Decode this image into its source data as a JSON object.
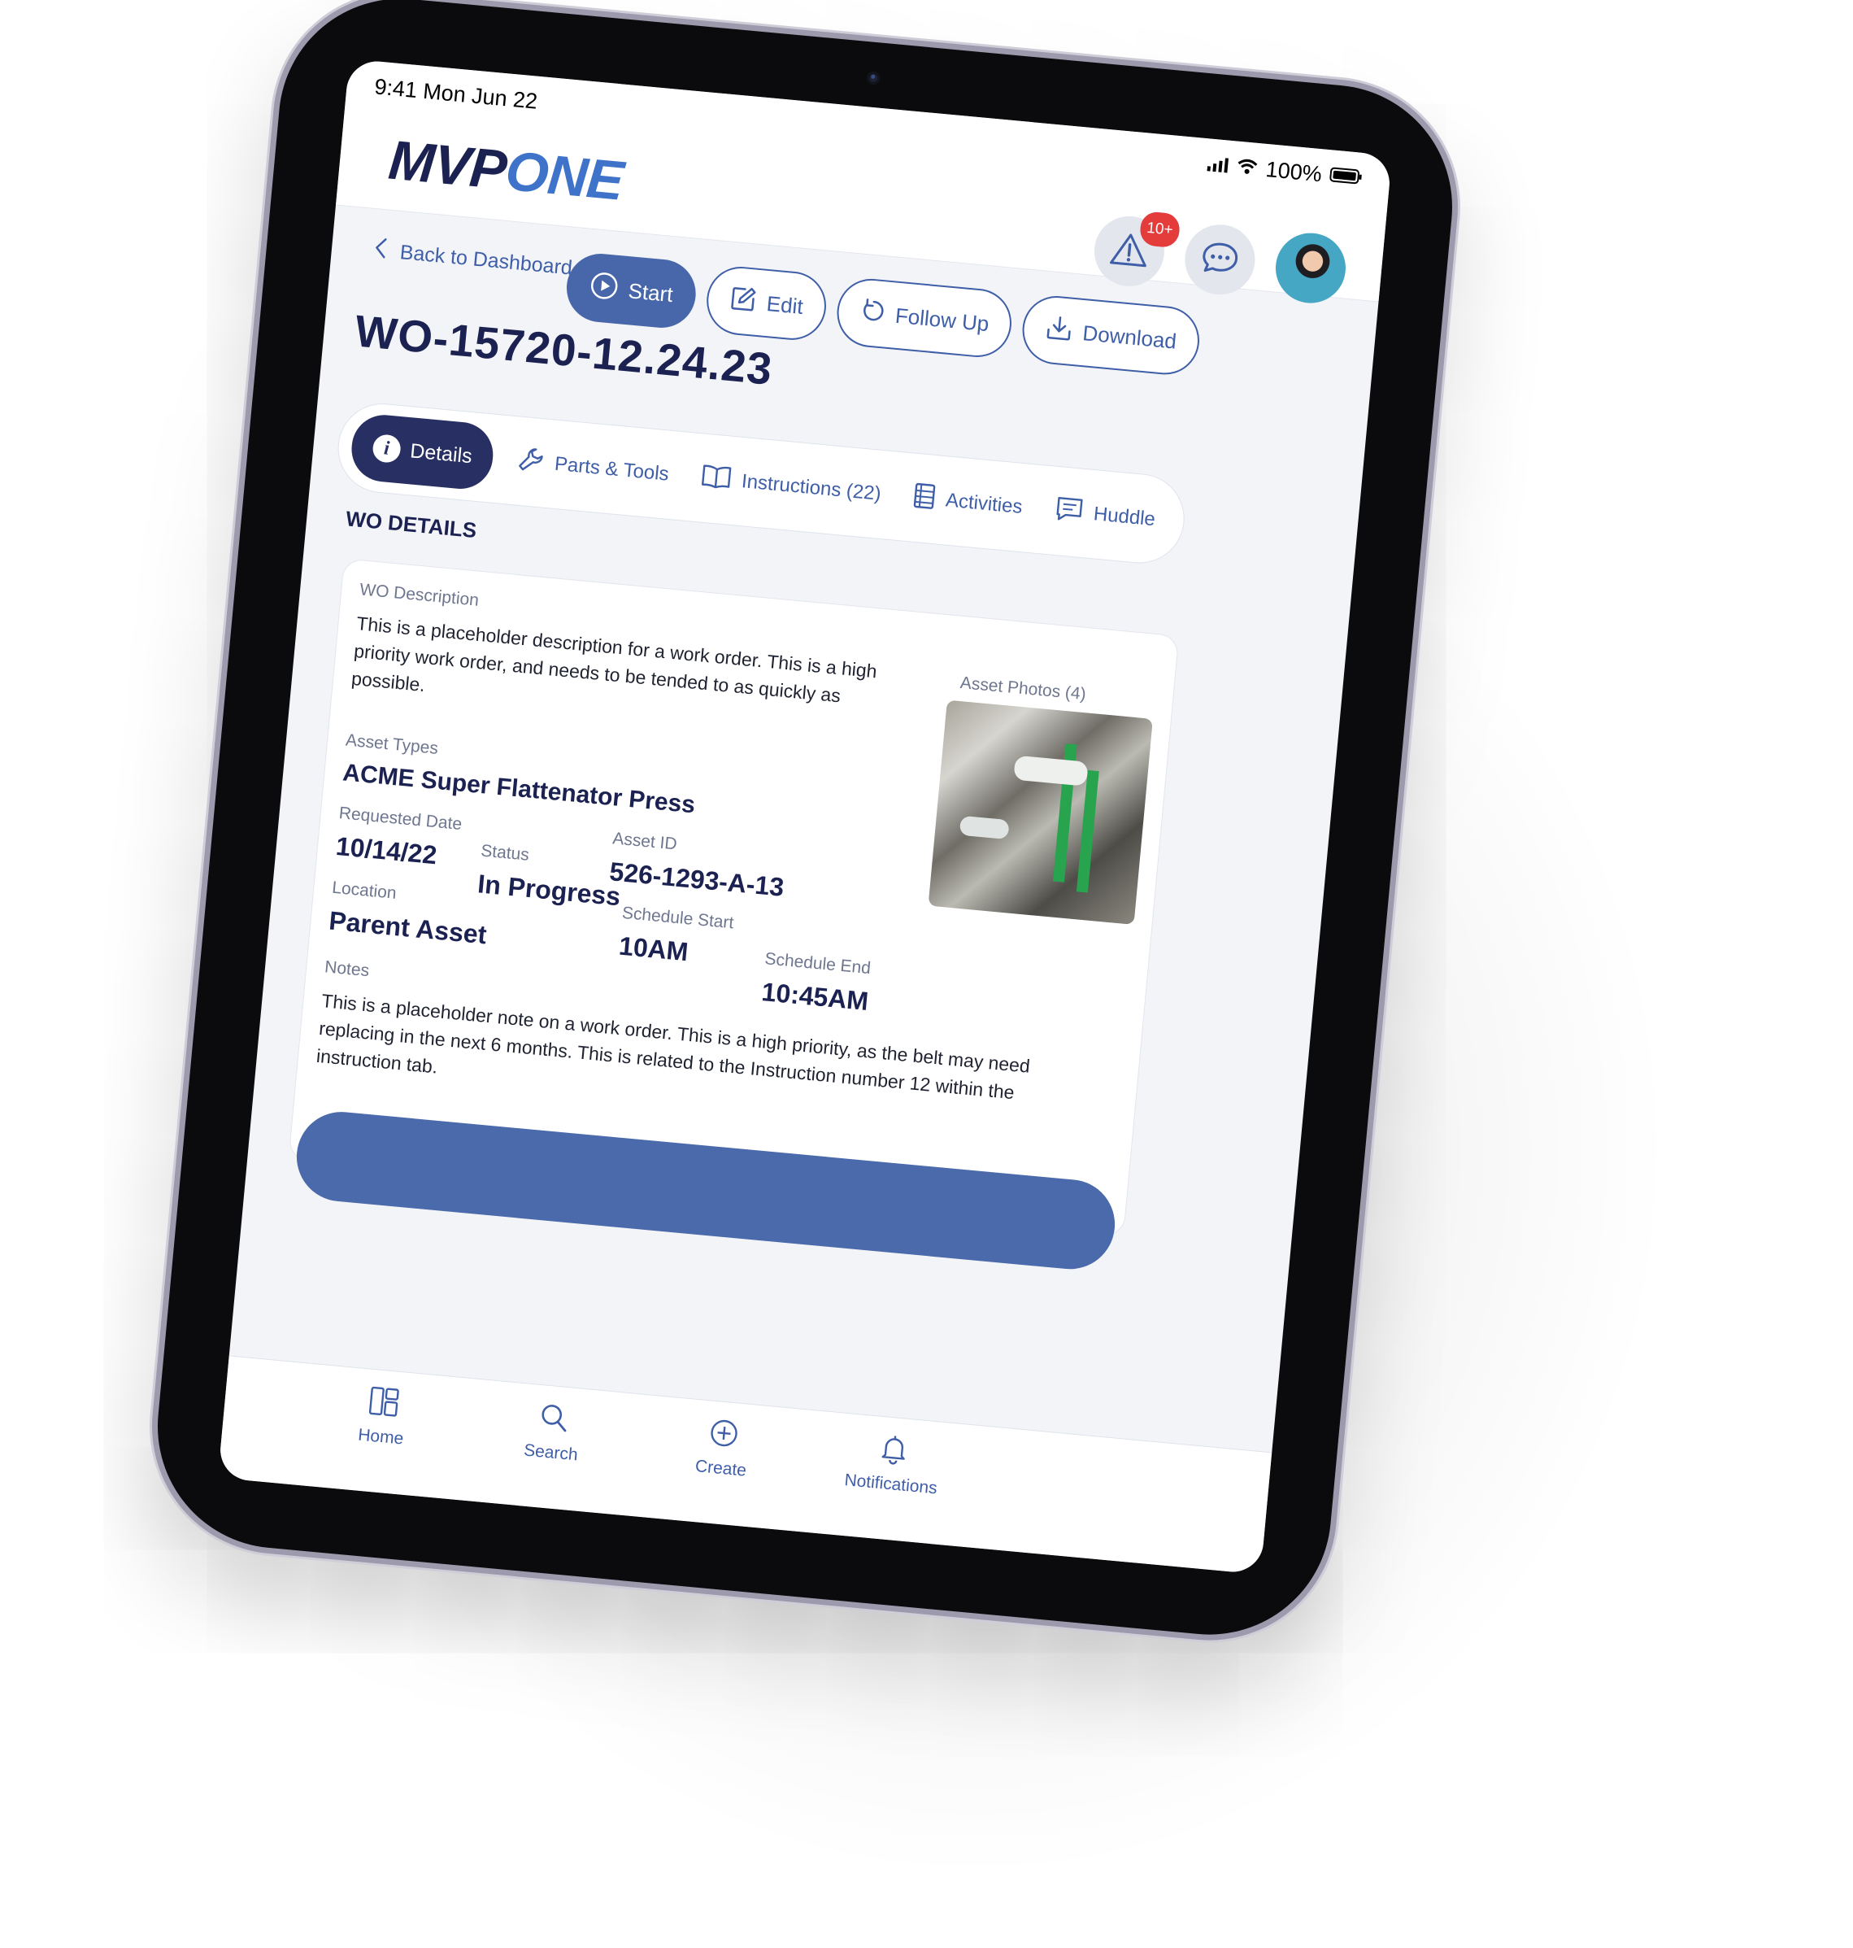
{
  "status": {
    "time": "9:41",
    "date": "Mon Jun 22",
    "battery": "100%",
    "icons": [
      "signal-icon",
      "wifi-icon",
      "battery-icon"
    ]
  },
  "header": {
    "logo_part1": "MVP",
    "logo_part2": "ONE",
    "alerts_badge": "10+"
  },
  "nav_back": "Back to Dashboard",
  "work_order": {
    "id": "WO-15720-12.24.23",
    "actions": {
      "start": "Start",
      "edit": "Edit",
      "follow_up": "Follow Up",
      "download": "Download"
    }
  },
  "tabs": [
    {
      "label": "Details",
      "icon": "info-icon"
    },
    {
      "label": "Parts & Tools",
      "icon": "wrench-icon"
    },
    {
      "label": "Instructions (22)",
      "icon": "book-icon"
    },
    {
      "label": "Activities",
      "icon": "list-icon"
    },
    {
      "label": "Huddle",
      "icon": "chat-lines-icon"
    }
  ],
  "details": {
    "section_title": "WO DETAILS",
    "description_label": "WO Description",
    "description_text": "This is a placeholder description for a work order. This is a high priority work order, and needs to be tended to as quickly as possible.",
    "asset_photos_label": "Asset Photos (4)",
    "asset_types_label": "Asset Types",
    "asset_types_value": "ACME Super Flattenator Press",
    "asset_id_label": "Asset ID",
    "asset_id_value": "526-1293-A-13",
    "requested_date_label": "Requested Date",
    "requested_date_value": "10/14/22",
    "status_label": "Status",
    "status_value": "In Progress",
    "schedule_start_label": "Schedule Start",
    "schedule_start_value": "10AM",
    "schedule_end_label": "Schedule End",
    "schedule_end_value": "10:45AM",
    "location_label": "Location",
    "location_value": "Parent Asset",
    "notes_label": "Notes",
    "notes_text": "This is a placeholder note on a work order. This is a high priority, as the belt may need replacing in the next 6 months. This is related to the Instruction number 12 within the instruction tab."
  },
  "bottom_nav": [
    {
      "label": "Home",
      "icon": "home-grid-icon"
    },
    {
      "label": "Search",
      "icon": "search-icon"
    },
    {
      "label": "Create",
      "icon": "plus-circle-icon"
    },
    {
      "label": "Notifications",
      "icon": "bell-icon"
    }
  ],
  "colors": {
    "brand_dark": "#1b2150",
    "brand_blue": "#3e73c9",
    "primary_button": "#4867ab",
    "active_tab": "#283063",
    "badge": "#e43b3b"
  }
}
